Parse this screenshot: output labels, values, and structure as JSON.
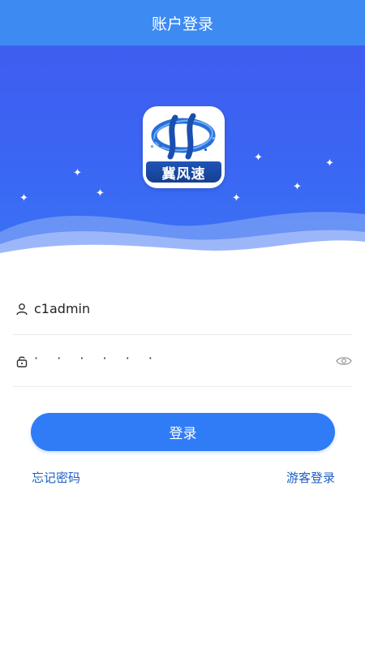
{
  "header": {
    "title": "账户登录"
  },
  "logo": {
    "text": "冀风速",
    "icon": "app-logo"
  },
  "form": {
    "username": {
      "value": "c1admin",
      "icon": "user-icon"
    },
    "password": {
      "masked_value": "· · · · · ·",
      "icon": "lock-icon",
      "toggle_icon": "eye-icon"
    }
  },
  "actions": {
    "login_label": "登录",
    "forgot_label": "忘记密码",
    "guest_label": "游客登录"
  },
  "colors": {
    "header_bg": "#3d8af2",
    "hero_bg": "#3f5df0",
    "primary_button": "#2f7cf6",
    "link": "#1f5fc0"
  }
}
